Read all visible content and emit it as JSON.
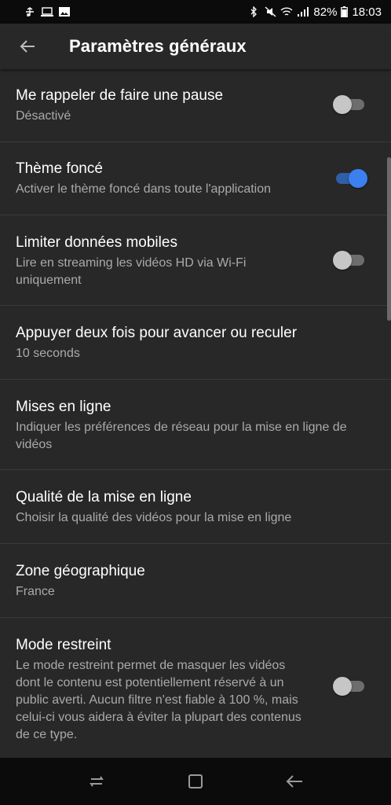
{
  "status_bar": {
    "battery": "82%",
    "time": "18:03",
    "left_icons": [
      "usb-icon",
      "laptop-icon",
      "image-icon"
    ],
    "right_icons": [
      "bluetooth-icon",
      "mute-icon",
      "wifi-icon",
      "signal-icon",
      "battery-icon"
    ]
  },
  "app_bar": {
    "title": "Paramètres généraux",
    "back_icon": "arrow-back-icon"
  },
  "settings": [
    {
      "title": "Me rappeler de faire une pause",
      "subtitle": "Désactivé",
      "toggle": false
    },
    {
      "title": "Thème foncé",
      "subtitle": "Activer le thème foncé dans toute l'application",
      "toggle": true
    },
    {
      "title": "Limiter données mobiles",
      "subtitle": "Lire en streaming les vidéos HD via Wi-Fi uniquement",
      "toggle": false
    },
    {
      "title": "Appuyer deux fois pour avancer ou reculer",
      "subtitle": "10 seconds"
    },
    {
      "title": "Mises en ligne",
      "subtitle": "Indiquer les préférences de réseau pour la mise en ligne de vidéos"
    },
    {
      "title": "Qualité de la mise en ligne",
      "subtitle": "Choisir la qualité des vidéos pour la mise en ligne"
    },
    {
      "title": "Zone géographique",
      "subtitle": "France"
    },
    {
      "title": "Mode restreint",
      "subtitle": "Le mode restreint permet de masquer les vidéos dont le contenu est potentiellement réservé à un public averti. Aucun filtre n'est fiable à 100 %, mais celui-ci vous aidera à éviter la plupart des contenus de ce type.",
      "toggle": false
    }
  ],
  "nav_bar": {
    "buttons": [
      "recent-apps-icon",
      "home-icon",
      "back-icon"
    ]
  },
  "colors": {
    "background": "#282828",
    "accent": "#3c7fef",
    "subtitle": "#aaaaaa"
  }
}
